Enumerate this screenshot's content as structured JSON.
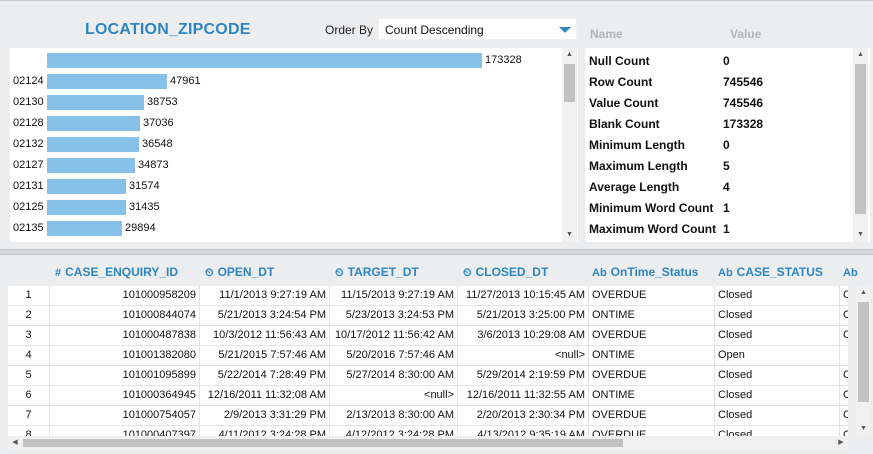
{
  "profile": {
    "title": "LOCATION_ZIPCODE",
    "order_by_label": "Order By",
    "order_by_value": "Count Descending"
  },
  "chart_data": {
    "type": "bar",
    "orientation": "horizontal",
    "categories": [
      "",
      "02124",
      "02130",
      "02128",
      "02132",
      "02127",
      "02131",
      "02125",
      "02135"
    ],
    "values": [
      173328,
      47961,
      38753,
      37036,
      36548,
      34873,
      31574,
      31435,
      29894
    ],
    "xlim": [
      0,
      173328
    ]
  },
  "stats": {
    "header_name": "Name",
    "header_value": "Value",
    "rows": [
      {
        "name": "Null Count",
        "value": "0"
      },
      {
        "name": "Row Count",
        "value": "745546"
      },
      {
        "name": "Value Count",
        "value": "745546"
      },
      {
        "name": "Blank Count",
        "value": "173328"
      },
      {
        "name": "Minimum Length",
        "value": "0"
      },
      {
        "name": "Maximum Length",
        "value": "5"
      },
      {
        "name": "Average Length",
        "value": "4"
      },
      {
        "name": "Minimum Word Count",
        "value": "1"
      },
      {
        "name": "Maximum Word Count",
        "value": "1"
      }
    ]
  },
  "grid": {
    "columns": [
      {
        "icon": "#",
        "label": "CASE_ENQUIRY_ID",
        "icon_name": "number-type-icon"
      },
      {
        "icon": "⏲",
        "label": "OPEN_DT",
        "icon_name": "datetime-type-icon"
      },
      {
        "icon": "⏲",
        "label": "TARGET_DT",
        "icon_name": "datetime-type-icon"
      },
      {
        "icon": "⏲",
        "label": "CLOSED_DT",
        "icon_name": "datetime-type-icon"
      },
      {
        "icon": "Ab",
        "label": "OnTime_Status",
        "icon_name": "text-type-icon"
      },
      {
        "icon": "Ab",
        "label": "CASE_STATUS",
        "icon_name": "text-type-icon"
      },
      {
        "icon": "Ab",
        "label": "",
        "icon_name": "text-type-icon"
      }
    ],
    "rows": [
      {
        "n": "1",
        "id": "101000958209",
        "open": "11/1/2013 9:27:19 AM",
        "target": "11/15/2013 9:27:19 AM",
        "closed": "11/27/2013 10:15:45 AM",
        "ontime": "OVERDUE",
        "status": "Closed",
        "extra": "Ca"
      },
      {
        "n": "2",
        "id": "101000844074",
        "open": "5/21/2013 3:24:54 PM",
        "target": "5/23/2013 3:24:53 PM",
        "closed": "5/21/2013 3:25:00 PM",
        "ontime": "ONTIME",
        "status": "Closed",
        "extra": "Ca"
      },
      {
        "n": "3",
        "id": "101000487838",
        "open": "10/3/2012 11:56:43 AM",
        "target": "10/17/2012 11:56:42 AM",
        "closed": "3/6/2013 10:29:08 AM",
        "ontime": "OVERDUE",
        "status": "Closed",
        "extra": "Ca"
      },
      {
        "n": "4",
        "id": "101001382080",
        "open": "5/21/2015 7:57:46 AM",
        "target": "5/20/2016 7:57:46 AM",
        "closed": "<null>",
        "ontime": "ONTIME",
        "status": "Open",
        "extra": ""
      },
      {
        "n": "5",
        "id": "101001095899",
        "open": "5/22/2014 7:28:49 PM",
        "target": "5/27/2014 8:30:00 AM",
        "closed": "5/29/2014 2:19:59 PM",
        "ontime": "OVERDUE",
        "status": "Closed",
        "extra": "Ca"
      },
      {
        "n": "6",
        "id": "101000364945",
        "open": "12/16/2011 11:32:08 AM",
        "target": "<null>",
        "closed": "12/16/2011 11:32:55 AM",
        "ontime": "ONTIME",
        "status": "Closed",
        "extra": "Ca"
      },
      {
        "n": "7",
        "id": "101000754057",
        "open": "2/9/2013 3:31:29 PM",
        "target": "2/13/2013 8:30:00 AM",
        "closed": "2/20/2013 2:30:34 PM",
        "ontime": "OVERDUE",
        "status": "Closed",
        "extra": "Ca"
      },
      {
        "n": "8",
        "id": "101000407397",
        "open": "4/11/2012 3:24:28 PM",
        "target": "4/12/2012 3:24:28 PM",
        "closed": "4/13/2012 9:35:19 AM",
        "ontime": "OVERDUE",
        "status": "Closed",
        "extra": "Ca"
      }
    ]
  },
  "colors": {
    "accent": "#2e86c1",
    "bar": "#85c1e9",
    "header_muted": "#b0b5bb"
  }
}
